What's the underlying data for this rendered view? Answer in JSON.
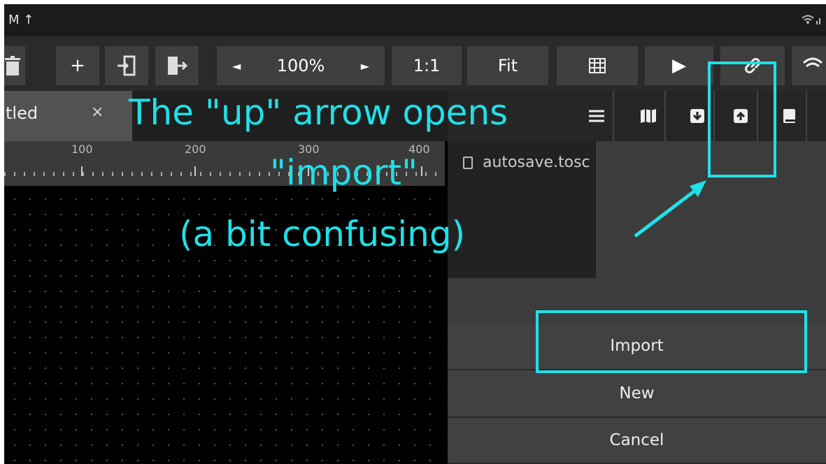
{
  "status_bar": {
    "left_icons": "M ↑",
    "right_icons": "wifi signal"
  },
  "toolbar": {
    "zoom_level": "100%",
    "zoom_prev": "◄",
    "zoom_next": "►",
    "ratio_label": "1:1",
    "fit_label": "Fit",
    "add_label": "+",
    "play_label": "▶"
  },
  "tab": {
    "label": "tled",
    "close": "×"
  },
  "ruler": {
    "marks": [
      "100",
      "200",
      "300",
      "400"
    ]
  },
  "file_browser": {
    "filename": "autosave.tosc"
  },
  "menu": {
    "import_label": "Import",
    "new_label": "New",
    "cancel_label": "Cancel"
  },
  "annotation": {
    "line1": "The \"up\" arrow opens",
    "line2": "\"import\"",
    "line3": "(a bit confusing)",
    "color": "#20e0e8"
  }
}
